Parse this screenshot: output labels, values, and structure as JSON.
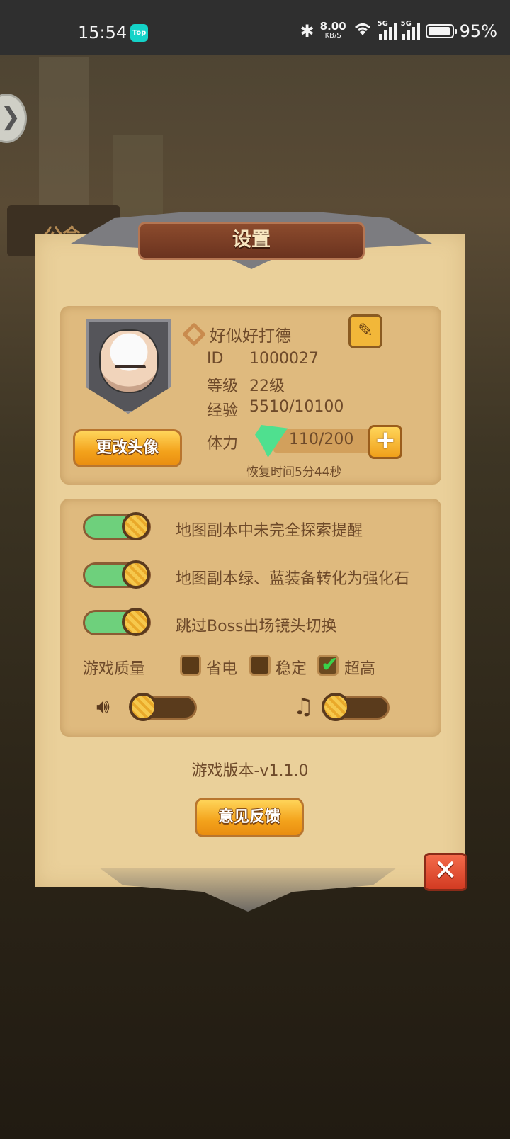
{
  "status_bar": {
    "time": "15:54",
    "app_badge": "Top",
    "net_speed": "8.00",
    "net_unit": "KB/S",
    "sim1": "5G",
    "sim2": "5G",
    "battery": "95%",
    "battery_level": 0.95
  },
  "background": {
    "side_tag": "公会"
  },
  "dialog": {
    "title": "设置",
    "profile": {
      "name": "好似好打德",
      "id_label": "ID",
      "id_value": "1000027",
      "level_label": "等级",
      "level_value": "22级",
      "exp_label": "经验",
      "exp_value": "5510/10100",
      "stamina_label": "体力",
      "stamina_value": "110/200",
      "recover_text": "恢复时间5分44秒",
      "change_avatar_label": "更改头像"
    },
    "options": [
      {
        "label": "地图副本中未完全探索提醒",
        "enabled": true
      },
      {
        "label": "地图副本绿、蓝装备转化为强化石",
        "enabled": true
      },
      {
        "label": "跳过Boss出场镜头切换",
        "enabled": true
      }
    ],
    "quality": {
      "label": "游戏质量",
      "choices": [
        {
          "label": "省电",
          "checked": false
        },
        {
          "label": "稳定",
          "checked": false
        },
        {
          "label": "超高",
          "checked": true
        }
      ]
    },
    "sound_level": 0,
    "music_level": 0,
    "version": "游戏版本-v1.1.0",
    "feedback_label": "意见反馈",
    "close_label": "✕"
  },
  "icons": {
    "edit": "edit-icon",
    "speaker": "speaker-icon",
    "music": "music-icon"
  }
}
